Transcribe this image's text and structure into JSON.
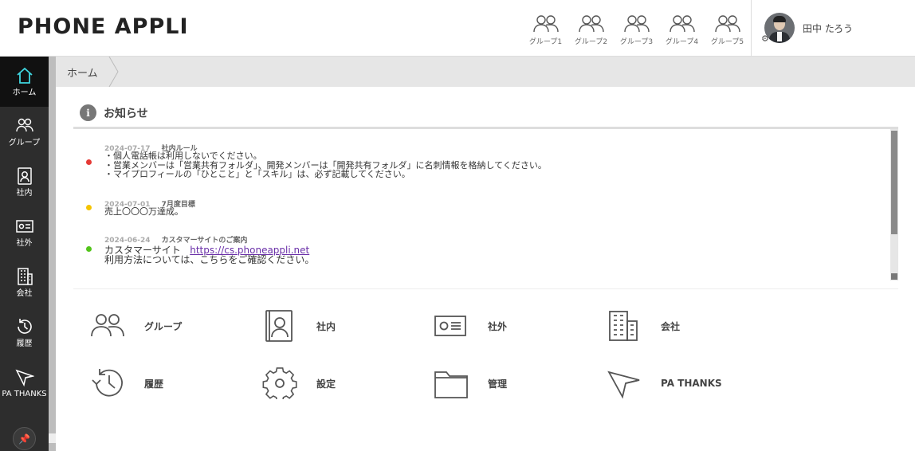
{
  "header": {
    "logo": "PHONE APPLI",
    "groups": [
      "グループ1",
      "グループ2",
      "グループ3",
      "グループ4",
      "グループ5"
    ],
    "user_name": "田中 たろう"
  },
  "sidebar": {
    "items": [
      {
        "label": "ホーム",
        "icon": "home-icon"
      },
      {
        "label": "グループ",
        "icon": "group-icon"
      },
      {
        "label": "社内",
        "icon": "internal-contacts-icon"
      },
      {
        "label": "社外",
        "icon": "external-contacts-icon"
      },
      {
        "label": "会社",
        "icon": "company-icon"
      },
      {
        "label": "履歴",
        "icon": "history-icon"
      },
      {
        "label": "PA THANKS",
        "icon": "paper-plane-icon"
      }
    ]
  },
  "breadcrumb": {
    "home": "ホーム"
  },
  "notice": {
    "title": "お知らせ",
    "items": [
      {
        "date": "2024-07-17",
        "title": "社内ルール",
        "color": "#e53935",
        "lines": [
          "・個人電話帳は利用しないでください。",
          "・営業メンバーは「営業共有フォルダ」、開発メンバーは「開発共有フォルダ」に名刺情報を格納してください。",
          "・マイプロフィールの「ひとこと」と「スキル」は、必ず記載してください。"
        ]
      },
      {
        "date": "2024-07-01",
        "title": "7月度目標",
        "color": "#f5c400",
        "lines": [
          "売上〇〇〇万達成。"
        ]
      },
      {
        "date": "2024-06-24",
        "title": "カスタマーサイトのご案内",
        "color": "#52c41a",
        "line1_prefix": "カスタマーサイト",
        "link": "https://cs.phoneappli.net",
        "line2": "利用方法については、こちらをご確認ください。"
      }
    ]
  },
  "menu": [
    {
      "label": "グループ",
      "icon": "group-icon"
    },
    {
      "label": "社内",
      "icon": "internal-contacts-icon"
    },
    {
      "label": "社外",
      "icon": "external-contacts-icon"
    },
    {
      "label": "会社",
      "icon": "company-icon"
    },
    {
      "label": "履歴",
      "icon": "history-icon"
    },
    {
      "label": "設定",
      "icon": "gear-icon"
    },
    {
      "label": "管理",
      "icon": "folder-icon"
    },
    {
      "label": "PA THANKS",
      "icon": "paper-plane-icon"
    }
  ]
}
